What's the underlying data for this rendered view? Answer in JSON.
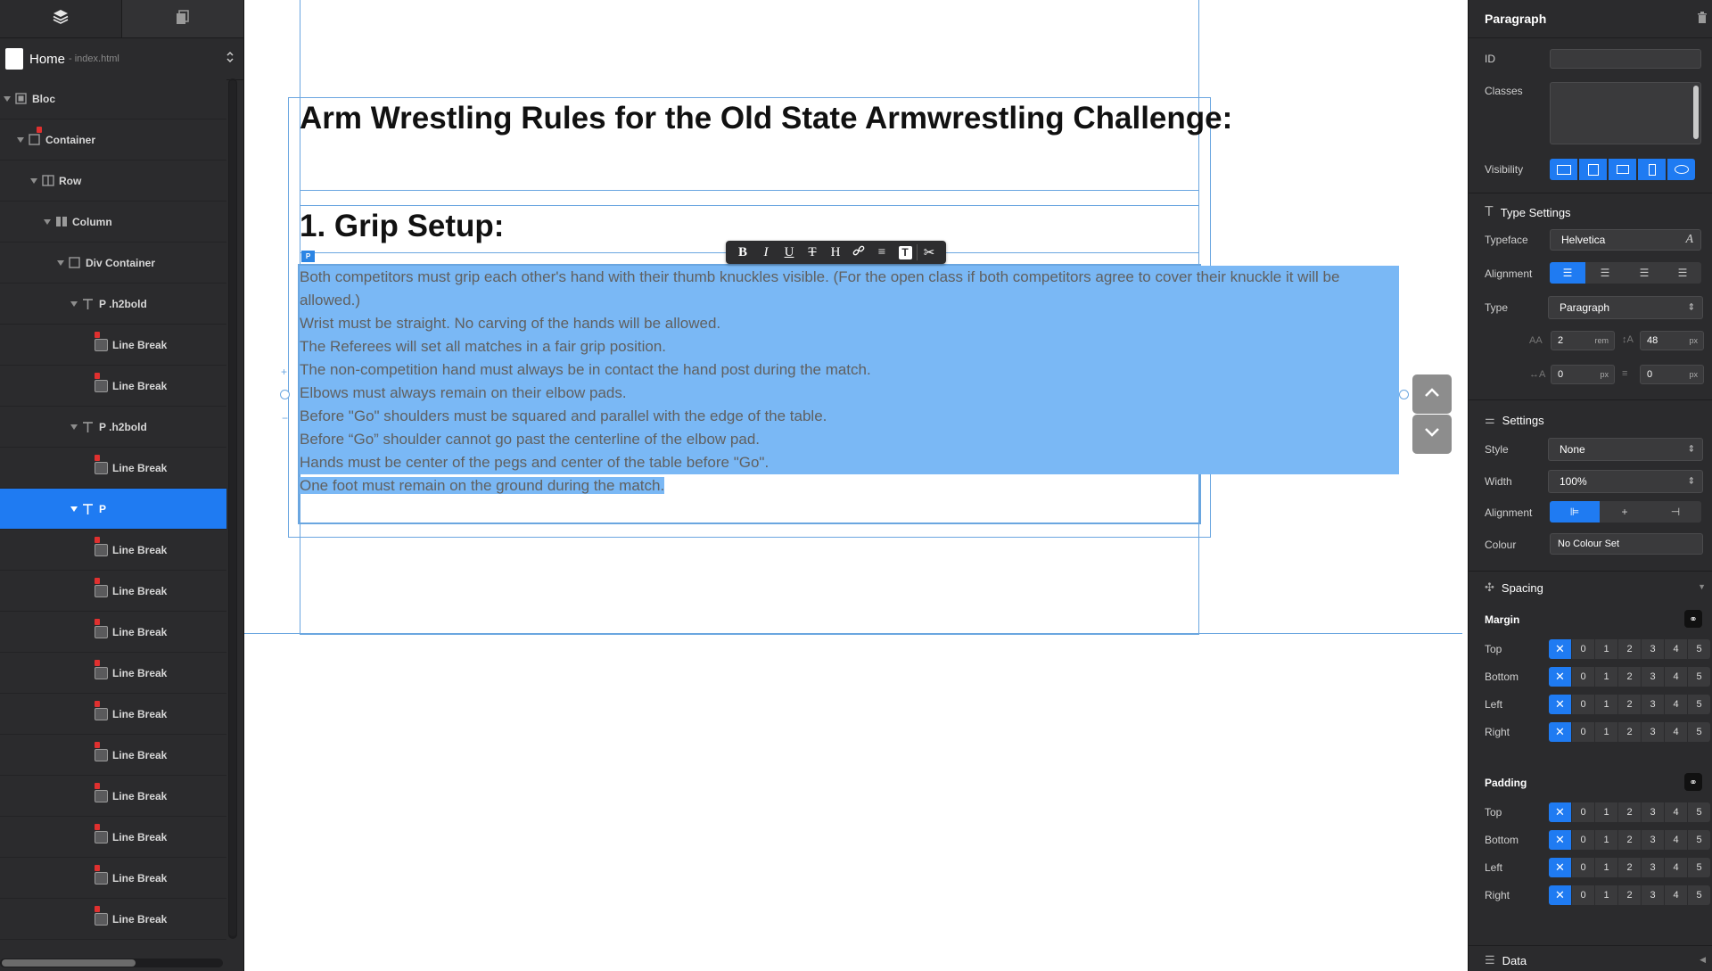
{
  "left_panel": {
    "page": {
      "name": "Home",
      "file": "- index.html"
    },
    "tree": [
      {
        "label": "Bloc",
        "depth": 0,
        "icon": "bloc-icon",
        "arrow": true
      },
      {
        "label": "Container",
        "depth": 1,
        "icon": "container-icon",
        "arrow": true,
        "locked": true
      },
      {
        "label": "Row",
        "depth": 2,
        "icon": "row-icon",
        "arrow": true
      },
      {
        "label": "Column",
        "depth": 3,
        "icon": "column-icon",
        "arrow": true
      },
      {
        "label": "Div Container",
        "depth": 4,
        "icon": "div-container-icon",
        "arrow": true
      },
      {
        "label": "P .h2bold",
        "depth": 5,
        "icon": "text-icon",
        "arrow": true
      },
      {
        "label": "Line Break",
        "depth": 6,
        "icon": "line-break-icon",
        "locked": true
      },
      {
        "label": "Line Break",
        "depth": 6,
        "icon": "line-break-icon",
        "locked": true
      },
      {
        "label": "P .h2bold",
        "depth": 5,
        "icon": "text-icon",
        "arrow": true
      },
      {
        "label": "Line Break",
        "depth": 6,
        "icon": "line-break-icon",
        "locked": true
      },
      {
        "label": "P",
        "depth": 5,
        "icon": "text-icon",
        "arrow": true,
        "selected": true
      },
      {
        "label": "Line Break",
        "depth": 6,
        "icon": "line-break-icon",
        "locked": true
      },
      {
        "label": "Line Break",
        "depth": 6,
        "icon": "line-break-icon",
        "locked": true
      },
      {
        "label": "Line Break",
        "depth": 6,
        "icon": "line-break-icon",
        "locked": true
      },
      {
        "label": "Line Break",
        "depth": 6,
        "icon": "line-break-icon",
        "locked": true
      },
      {
        "label": "Line Break",
        "depth": 6,
        "icon": "line-break-icon",
        "locked": true
      },
      {
        "label": "Line Break",
        "depth": 6,
        "icon": "line-break-icon",
        "locked": true
      },
      {
        "label": "Line Break",
        "depth": 6,
        "icon": "line-break-icon",
        "locked": true
      },
      {
        "label": "Line Break",
        "depth": 6,
        "icon": "line-break-icon",
        "locked": true
      },
      {
        "label": "Line Break",
        "depth": 6,
        "icon": "line-break-icon",
        "locked": true
      },
      {
        "label": "Line Break",
        "depth": 6,
        "icon": "line-break-icon",
        "locked": true
      }
    ]
  },
  "canvas": {
    "heading1": "Arm Wrestling Rules for the Old State Armwrestling Challenge:",
    "heading2": "1. Grip Setup:",
    "p_tag": "P",
    "paragraph_lines": [
      "Both competitors must grip each other's hand with their thumb knuckles visible. (For the open class if both competitors agree to cover their knuckle it will be allowed.)",
      "Wrist must be straight.  No carving of the hands will be allowed.",
      "The Referees will set all matches in a fair grip position.",
      "The non-competition hand must always be in contact the hand post during the match.",
      "Elbows must always remain on their elbow pads.",
      "Before \"Go\" shoulders must be squared and parallel with the edge of the table.",
      "Before “Go” shoulder cannot go past the centerline of the elbow pad.",
      "Hands must be center of the pegs and center of the table before \"Go\".",
      "One foot must remain on the ground during the match."
    ],
    "toolbar": {
      "bold": "B",
      "italic": "I",
      "underline": "U",
      "strike": "T",
      "heading": "H",
      "list": "≡",
      "text": "T",
      "clear": "✂"
    }
  },
  "right_panel": {
    "title": "Paragraph",
    "id_label": "ID",
    "id_value": "",
    "classes_label": "Classes",
    "visibility_label": "Visibility",
    "type_settings_title": "Type Settings",
    "typeface_label": "Typeface",
    "typeface_value": "Helvetica",
    "alignment_label": "Alignment",
    "type_label": "Type",
    "type_value": "Paragraph",
    "font_size": "2",
    "font_size_unit": "rem",
    "line_height": "48",
    "line_height_unit": "px",
    "letter_spacing": "0",
    "letter_spacing_unit": "px",
    "word_spacing": "0",
    "word_spacing_unit": "px",
    "settings_title": "Settings",
    "style_label": "Style",
    "style_value": "None",
    "width_label": "Width",
    "width_value": "100%",
    "settings_alignment_label": "Alignment",
    "colour_label": "Colour",
    "colour_value": "No Colour Set",
    "spacing_title": "Spacing",
    "margin_title": "Margin",
    "padding_title": "Padding",
    "spacing_rows": [
      "Top",
      "Bottom",
      "Left",
      "Right"
    ],
    "spacing_values": [
      "0",
      "1",
      "2",
      "3",
      "4",
      "5"
    ],
    "data_title": "Data"
  },
  "colors": {
    "accent": "#1f7bf2",
    "panel": "#2b2b2d",
    "highlight": "#7ab8f5",
    "guide": "#6aa6e0"
  }
}
